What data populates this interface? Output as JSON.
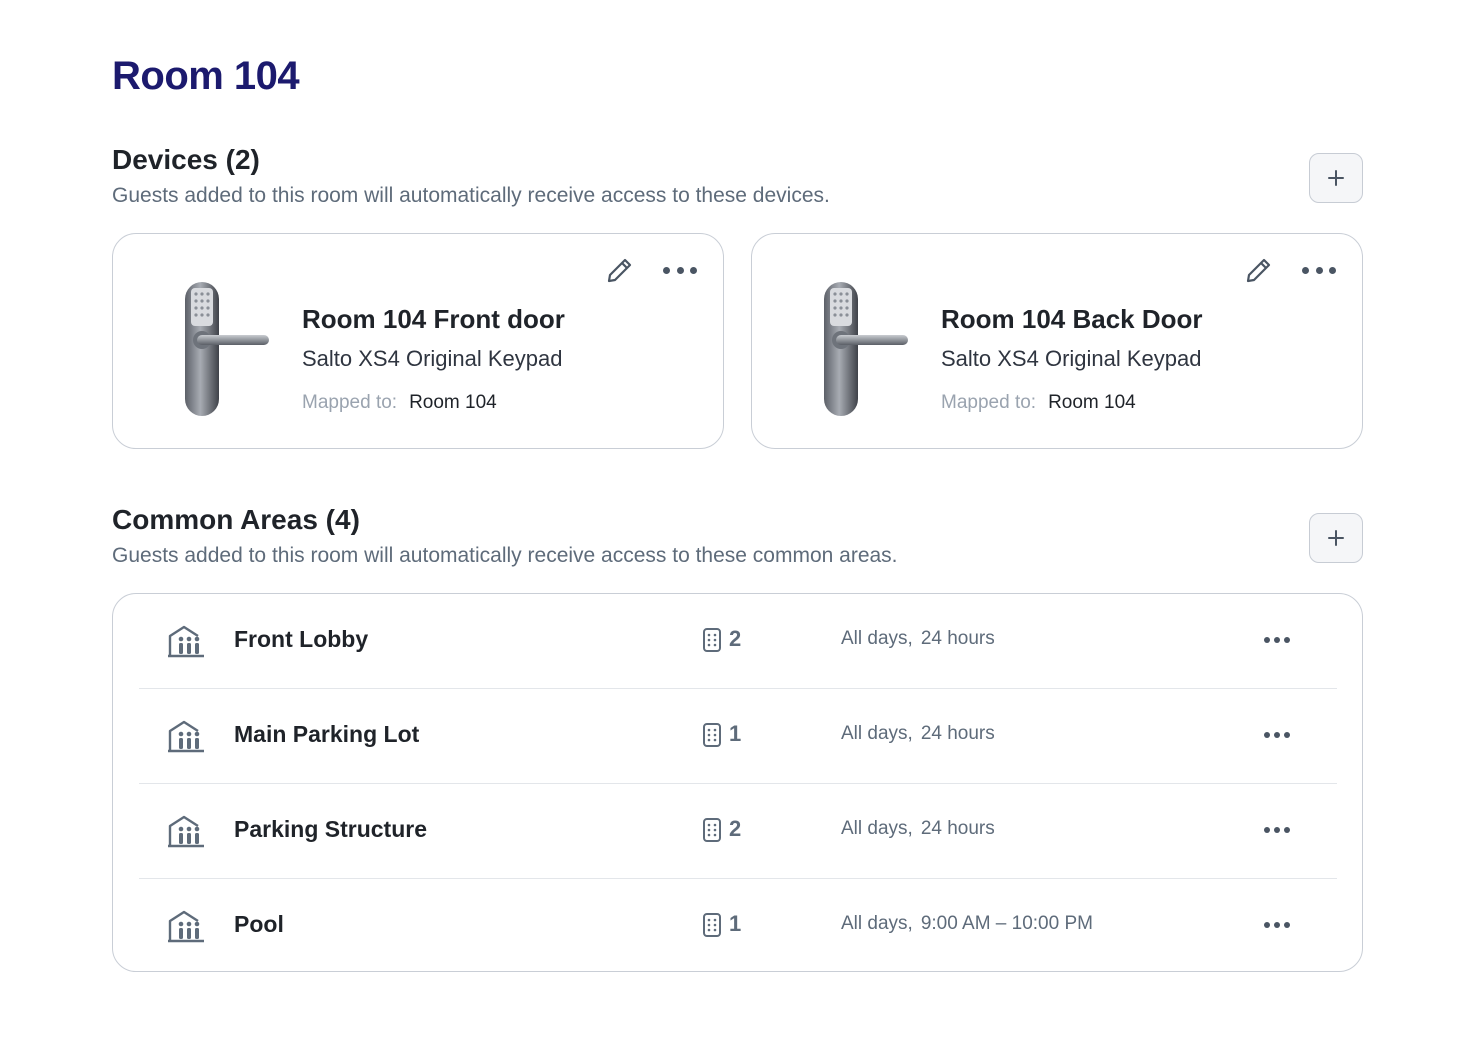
{
  "page": {
    "title": "Room 104"
  },
  "devices": {
    "title": "Devices (2)",
    "subtitle": "Guests added to this room will automatically receive access to these devices.",
    "add_icon": "plus-icon",
    "mapped_label": "Mapped to:",
    "items": [
      {
        "name": "Room 104 Front door",
        "model": "Salto XS4 Original Keypad",
        "mapped_to": "Room 104",
        "icon": "keypad-lock-image"
      },
      {
        "name": "Room 104 Back Door",
        "model": "Salto XS4 Original Keypad",
        "mapped_to": "Room 104",
        "icon": "keypad-lock-image"
      }
    ]
  },
  "common_areas": {
    "title": "Common Areas (4)",
    "subtitle": "Guests added to this room will automatically receive access to these common areas.",
    "add_icon": "plus-icon",
    "items": [
      {
        "name": "Front Lobby",
        "lock_count": "2",
        "days": "All days,",
        "hours": "24 hours"
      },
      {
        "name": "Main Parking Lot",
        "lock_count": "1",
        "days": "All days,",
        "hours": "24 hours"
      },
      {
        "name": "Parking Structure",
        "lock_count": "2",
        "days": "All days,",
        "hours": "24 hours"
      },
      {
        "name": "Pool",
        "lock_count": "1",
        "days": "All days,",
        "hours": "9:00 AM – 10:00 PM"
      }
    ]
  },
  "colors": {
    "title": "#1c1a6e",
    "text": "#1f2329",
    "muted": "#5e6b7a",
    "border": "#c9ced6"
  }
}
